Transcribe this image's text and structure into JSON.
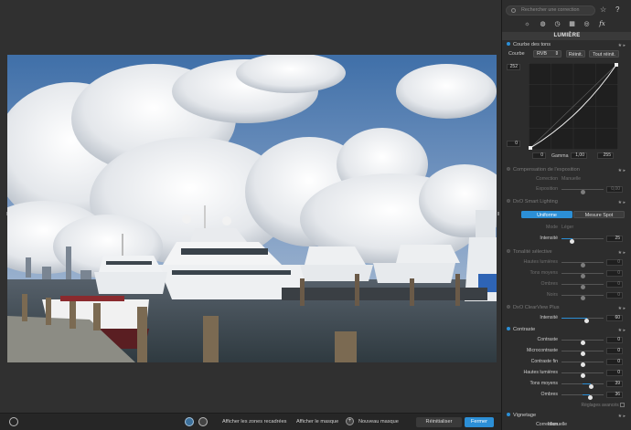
{
  "search": {
    "placeholder": "Rechercher une correction"
  },
  "header_icons": [
    "star-icon",
    "help-icon"
  ],
  "palette_tabs": [
    "sun-icon",
    "color-palette-icon",
    "clock-icon",
    "texture-icon",
    "lens-icon",
    "fx-icon"
  ],
  "fx_label": "fx",
  "section_title": "LUMIÈRE",
  "tone_curve": {
    "title": "Courbe des tons",
    "curve_label": "Courbe",
    "channel": "RVB",
    "reset": "Réinit.",
    "reset_all": "Tout réinit.",
    "top_value": "252",
    "bottom_value": "0",
    "in_low": "0",
    "gamma_label": "Gamma",
    "gamma": "1,00",
    "in_high": "255"
  },
  "exposure": {
    "title": "Compensation de l'exposition",
    "correction_label": "Correction",
    "correction_value": "Manuelle",
    "exposure_label": "Exposition",
    "exposure_value": "0,00",
    "exposure_level": 0.5
  },
  "smart_lighting": {
    "title": "DxO Smart Lighting",
    "uniform": "Uniforme",
    "spot": "Mesure Spot",
    "mode_label": "Mode",
    "mode_value": "Léger",
    "intensity_label": "Intensité",
    "intensity_value": "25",
    "intensity_level": 0.25
  },
  "selective_tone": {
    "title": "Tonalité sélective",
    "rows": [
      {
        "label": "Hautes lumières",
        "value": "0"
      },
      {
        "label": "Tons moyens",
        "value": "0"
      },
      {
        "label": "Ombres",
        "value": "0"
      },
      {
        "label": "Noirs",
        "value": "0"
      }
    ]
  },
  "clearview": {
    "title": "DxO ClearView Plus",
    "intensity_label": "Intensité",
    "intensity_value": "60",
    "intensity_level": 0.6
  },
  "contrast": {
    "title": "Contraste",
    "rows": [
      {
        "label": "Contraste",
        "value": "0",
        "level": 0.5
      },
      {
        "label": "Microcontraste",
        "value": "0",
        "level": 0.5
      },
      {
        "label": "Contraste fin",
        "value": "0",
        "level": 0.5
      },
      {
        "label": "Hautes lumières",
        "value": "0",
        "level": 0.5
      },
      {
        "label": "Tons moyens",
        "value": "39",
        "level": 0.7
      },
      {
        "label": "Ombres",
        "value": "36",
        "level": 0.68
      }
    ],
    "advanced": "Réglages avancés"
  },
  "vignetting": {
    "title": "Vignetage",
    "correction_label": "Correction",
    "correction_value": "Manuelle"
  },
  "toolbar": {
    "show_crop": "Afficher les zones recadrées",
    "show_mask": "Afficher le masque",
    "new_mask": "Nouveau masque",
    "reset": "Réinitialiser",
    "close": "Fermer"
  },
  "colors": {
    "accent": "#2c8fd6",
    "panel": "#2d2d2d",
    "viewer": "#303030"
  }
}
